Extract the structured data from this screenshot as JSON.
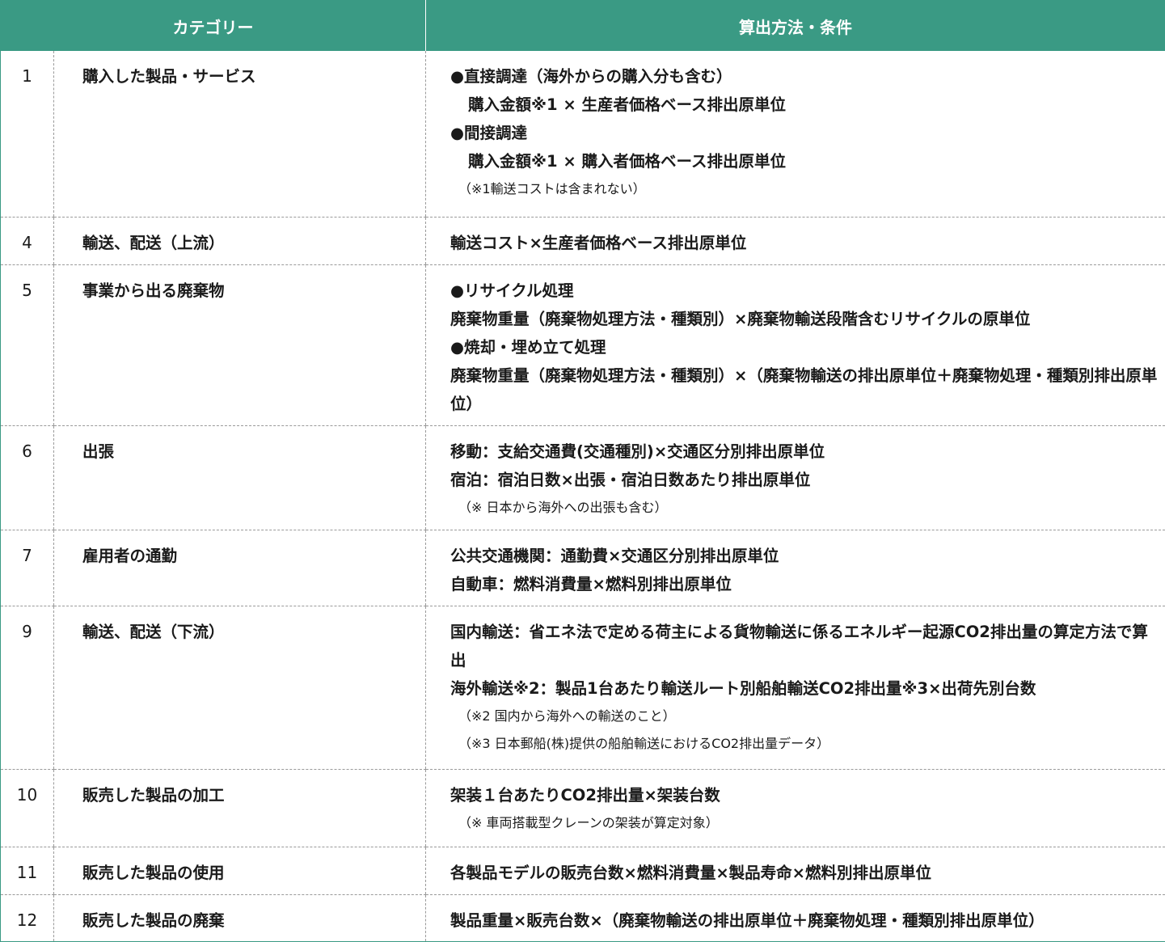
{
  "header": {
    "category": "カテゴリー",
    "method": "算出方法・条件"
  },
  "colors": {
    "header_bg": "#3a9a84",
    "header_text": "#ffffff",
    "divider": "#9a9a9a"
  },
  "rows": [
    {
      "num": "1",
      "category": "購入した製品・サービス",
      "lines": [
        "●直接調達（海外からの購入分も含む）",
        "購入金額※1 × 生産者価格ベース排出原単位",
        "●間接調達",
        "購入金額※1 × 購入者価格ベース排出原単位"
      ],
      "notes": [
        "（※1輸送コストは含まれない）"
      ]
    },
    {
      "num": "4",
      "category": "輸送、配送（上流）",
      "lines": [
        "輸送コスト×生産者価格ベース排出原単位"
      ],
      "notes": []
    },
    {
      "num": "5",
      "category": "事業から出る廃棄物",
      "lines": [
        "●リサイクル処理",
        "廃棄物重量（廃棄物処理方法・種類別）×廃棄物輸送段階含むリサイクルの原単位",
        "●焼却・埋め立て処理",
        "廃棄物重量（廃棄物処理方法・種類別）×（廃棄物輸送の排出原単位＋廃棄物処理・種類別排出原単位）"
      ],
      "notes": []
    },
    {
      "num": "6",
      "category": "出張",
      "lines": [
        "移動：支給交通費(交通種別)×交通区分別排出原単位",
        "宿泊：宿泊日数×出張・宿泊日数あたり排出原単位"
      ],
      "notes": [
        "（※ 日本から海外への出張も含む）"
      ]
    },
    {
      "num": "7",
      "category": "雇用者の通勤",
      "lines": [
        "公共交通機関：通勤費×交通区分別排出原単位",
        "自動車：燃料消費量×燃料別排出原単位"
      ],
      "notes": []
    },
    {
      "num": "9",
      "category": "輸送、配送（下流）",
      "lines": [
        "国内輸送：省エネ法で定める荷主による貨物輸送に係るエネルギー起源CO2排出量の算定方法で算出",
        "海外輸送※2：製品1台あたり輸送ルート別船舶輸送CO2排出量※3×出荷先別台数"
      ],
      "notes": [
        "（※2 国内から海外への輸送のこと）",
        "（※3 日本郵船(株)提供の船舶輸送におけるCO2排出量データ）"
      ]
    },
    {
      "num": "10",
      "category": "販売した製品の加工",
      "lines": [
        "架装１台あたりCO2排出量×架装台数"
      ],
      "notes": [
        "（※ 車両搭載型クレーンの架装が算定対象）"
      ]
    },
    {
      "num": "11",
      "category": "販売した製品の使用",
      "lines": [
        "各製品モデルの販売台数×燃料消費量×製品寿命×燃料別排出原単位"
      ],
      "notes": []
    },
    {
      "num": "12",
      "category": "販売した製品の廃棄",
      "lines": [
        "製品重量×販売台数×（廃棄物輸送の排出原単位＋廃棄物処理・種類別排出原単位）"
      ],
      "notes": []
    }
  ]
}
